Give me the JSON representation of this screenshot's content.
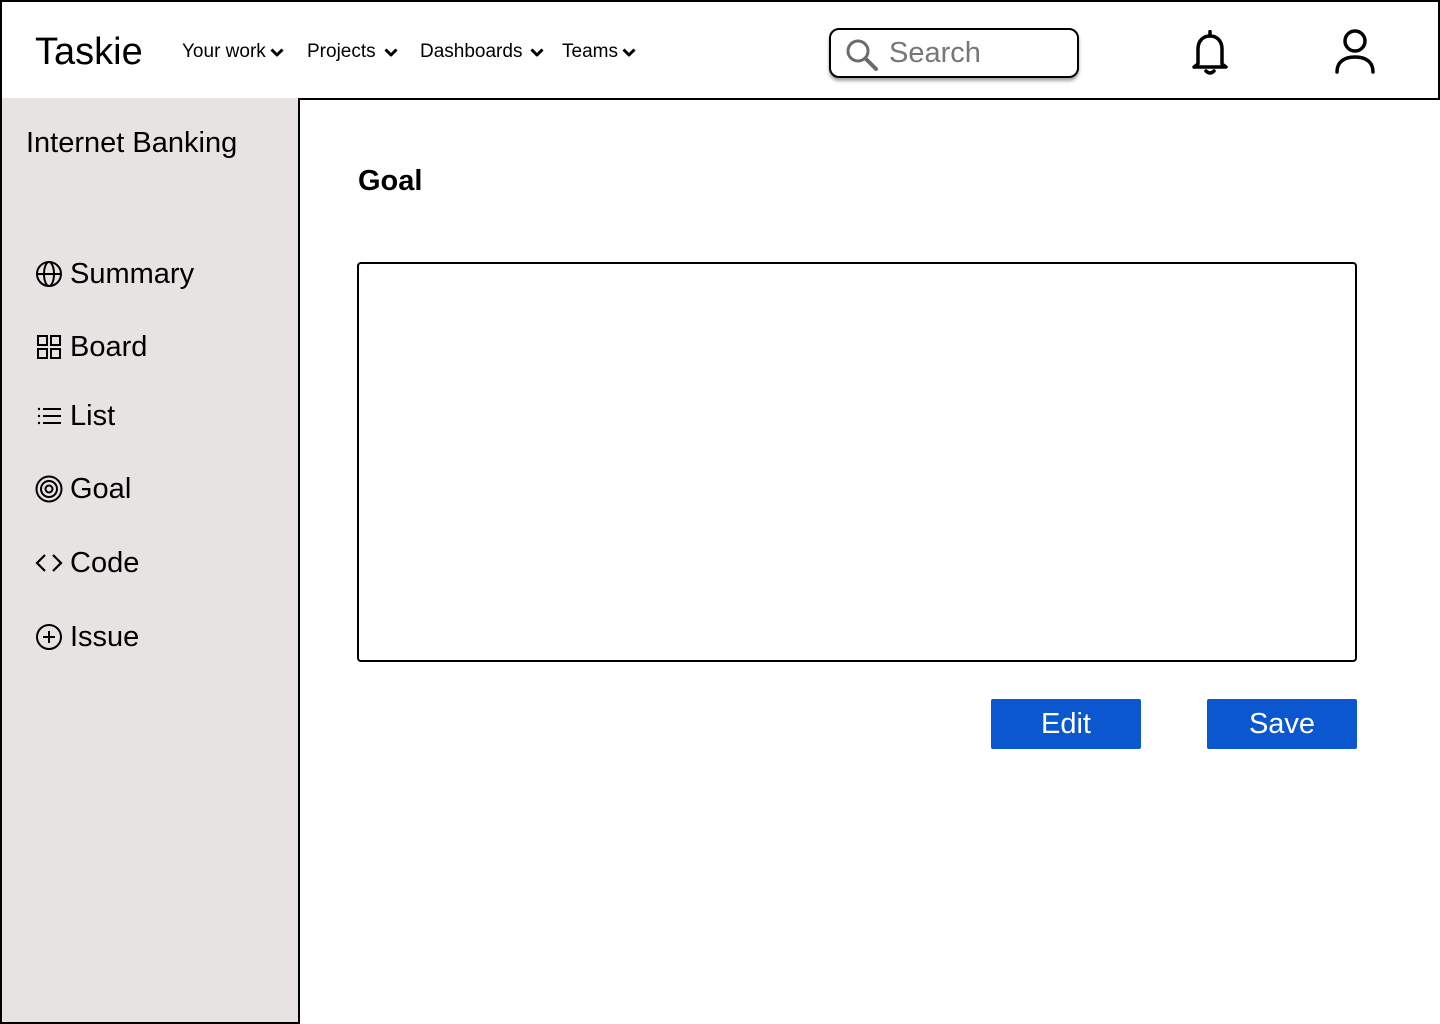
{
  "app": {
    "logo": "Taskie"
  },
  "nav": [
    {
      "label": "Your work",
      "icon": "chevron-down-icon"
    },
    {
      "label": "Projects",
      "icon": "chevron-down-icon"
    },
    {
      "label": "Dashboards",
      "icon": "chevron-down-icon"
    },
    {
      "label": "Teams",
      "icon": "chevron-down-icon"
    }
  ],
  "search": {
    "placeholder": "Search",
    "value": "",
    "icon": "search-icon"
  },
  "header_icons": {
    "notifications": "bell-icon",
    "profile": "user-icon"
  },
  "sidebar": {
    "project_name": "Internet Banking",
    "items": [
      {
        "label": "Summary",
        "icon": "globe-icon"
      },
      {
        "label": "Board",
        "icon": "grid-icon"
      },
      {
        "label": "List",
        "icon": "list-icon"
      },
      {
        "label": "Goal",
        "icon": "target-icon"
      },
      {
        "label": "Code",
        "icon": "code-icon"
      },
      {
        "label": "Issue",
        "icon": "plus-circle-icon"
      }
    ]
  },
  "main": {
    "title": "Goal",
    "goal_text": "",
    "buttons": {
      "edit_label": "Edit",
      "save_label": "Save"
    }
  },
  "colors": {
    "sidebar_bg": "#e7e3e2",
    "button_bg": "#0a57cf",
    "button_text": "#ffffff"
  }
}
